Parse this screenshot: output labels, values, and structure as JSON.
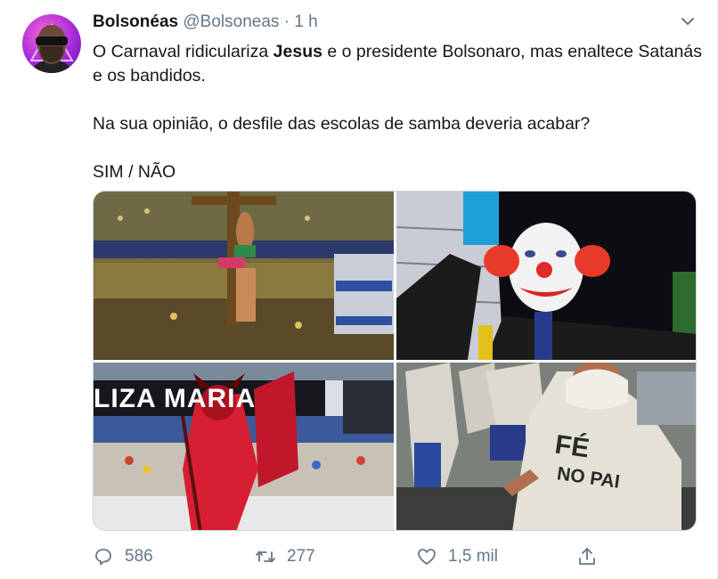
{
  "tweet": {
    "author_name": "Bolsonéas",
    "handle": "@Bolsoneas",
    "separator": "·",
    "time": "1 h",
    "text_line1_pre": "O Carnaval ridiculariza ",
    "text_line1_bold": "Jesus",
    "text_line1_post": " e o presidente Bolsonaro, mas enaltece Satanás e os bandidos.",
    "text_line2": "Na sua opinião, o desfile das escolas de samba deveria acabar?",
    "text_line3": "SIM / NÃO",
    "photo3_banner": "LIZA MARIA",
    "photo4_sign_line1": "FÉ",
    "photo4_sign_line2": "NO PAI"
  },
  "actions": {
    "reply_count": "586",
    "retweet_count": "277",
    "like_count": "1,5 mil"
  },
  "colors": {
    "secondary_text": "#657786",
    "border": "#e6ecf0"
  },
  "icons": [
    "chevron-down-icon",
    "reply-icon",
    "retweet-icon",
    "like-icon",
    "share-icon"
  ]
}
